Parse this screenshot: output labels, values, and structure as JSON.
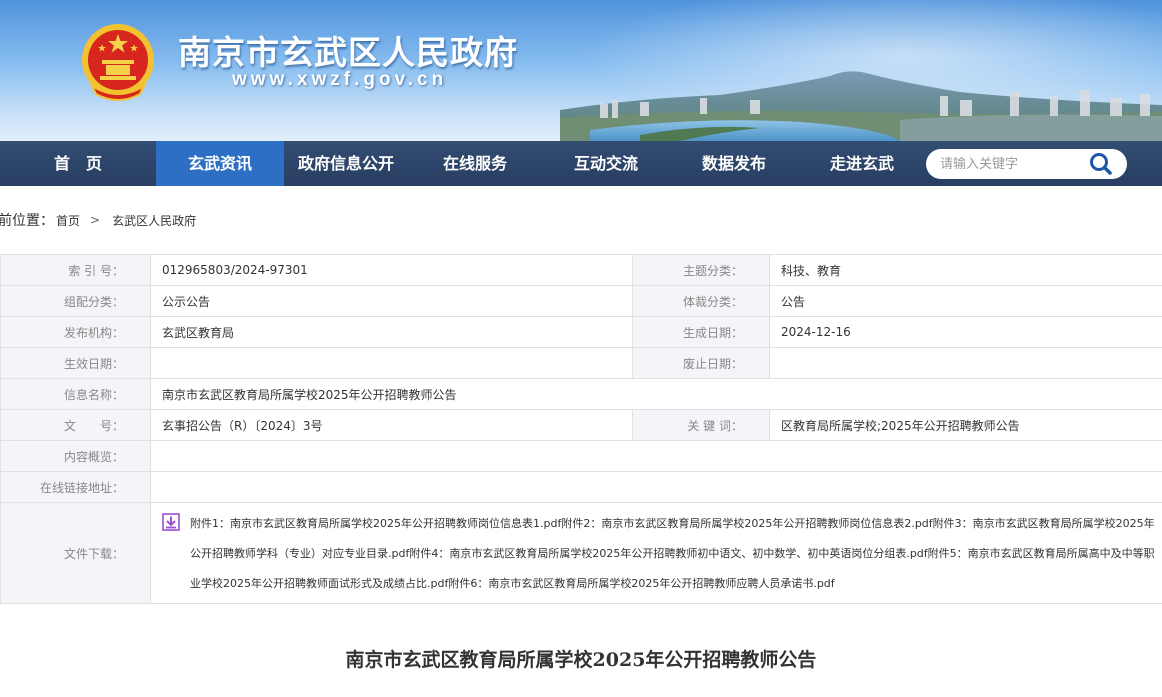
{
  "header": {
    "site_title": "南京市玄武区人民政府",
    "site_url": "www.xwzf.gov.cn",
    "emblem_icon": "national-emblem-icon"
  },
  "nav": {
    "items": [
      {
        "label": "首　页"
      },
      {
        "label": "玄武资讯"
      },
      {
        "label": "政府信息公开"
      },
      {
        "label": "在线服务"
      },
      {
        "label": "互动交流"
      },
      {
        "label": "数据发布"
      },
      {
        "label": "走进玄武"
      }
    ],
    "active_index": 1,
    "search_placeholder": "请输入关键字",
    "search_icon": "search-icon"
  },
  "breadcrumb": {
    "label": "前位置：",
    "items": [
      "首页",
      "玄武区人民政府"
    ],
    "separator": ">"
  },
  "info": {
    "index_label": "索 引 号：",
    "index_value": "012965803/2024-97301",
    "topic_label": "主题分类：",
    "topic_value": "科技、教育",
    "category_label": "组配分类：",
    "category_value": "公示公告",
    "genre_label": "体裁分类：",
    "genre_value": "公告",
    "publisher_label": "发布机构：",
    "publisher_value": "玄武区教育局",
    "created_label": "生成日期：",
    "created_value": "2024-12-16",
    "effective_label": "生效日期：",
    "effective_value": "",
    "abolished_label": "废止日期：",
    "abolished_value": "",
    "name_label": "信息名称：",
    "name_value": "南京市玄武区教育局所属学校2025年公开招聘教师公告",
    "docno_label": "文　　号：",
    "docno_value": "玄事招公告（R）〔2024〕3号",
    "keywords_label": "关 键 词：",
    "keywords_value": "区教育局所属学校;2025年公开招聘教师公告",
    "summary_label": "内容概览：",
    "summary_value": "",
    "link_label": "在线链接地址：",
    "link_value": "",
    "download_label": "文件下载：",
    "download_icon": "download-icon",
    "attachments": [
      "附件1：南京市玄武区教育局所属学校2025年公开招聘教师岗位信息表1.pdf",
      "附件2：南京市玄武区教育局所属学校2025年公开招聘教师岗位信息表2.pdf",
      "附件3：南京市玄武区教育局所属学校2025年公开招聘教师学科（专业）对应专业目录.pdf",
      "附件4：南京市玄武区教育局所属学校2025年公开招聘教师初中语文、初中数学、初中英语岗位分组表.pdf",
      "附件5：南京市玄武区教育局所属高中及中等职业学校2025年公开招聘教师面试形式及成绩占比.pdf",
      "附件6：南京市玄武区教育局所属学校2025年公开招聘教师应聘人员承诺书.pdf"
    ]
  },
  "article": {
    "title": "南京市玄武区教育局所属学校2025年公开招聘教师公告"
  },
  "colors": {
    "nav_bg": "#223d66",
    "nav_active": "#2d6fc4",
    "label_bg": "#f3f5f8",
    "border": "#e1e1e1",
    "download_icon": "#9b4fd0"
  }
}
